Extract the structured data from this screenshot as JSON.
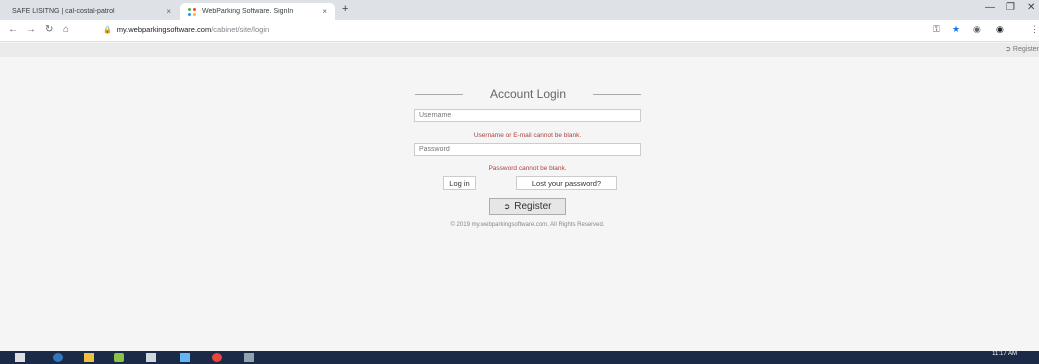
{
  "browser": {
    "tabs": [
      {
        "title": "SAFE LISITNG | cal-costal-patrol",
        "close": "×"
      },
      {
        "title": "WebParking Software. SignIn",
        "close": "×"
      }
    ],
    "new_tab": "+",
    "window_controls": {
      "minimize": "—",
      "maximize": "❐",
      "close": "✕"
    },
    "nav": {
      "back": "←",
      "forward": "→",
      "reload": "↻",
      "home": "⌂"
    },
    "url_host": "my.webparkingsoftware.com",
    "url_path": "/cabinet/site/login",
    "toolbar_icons": [
      "key-icon",
      "star-icon",
      "extension-icon",
      "profile-icon",
      "menu-icon"
    ]
  },
  "page": {
    "top_register_link": "Register",
    "heading": "Account Login",
    "username_placeholder": "Username",
    "username_error": "Username or E-mail cannot be blank.",
    "password_placeholder": "Password",
    "password_error": "Password cannot be blank.",
    "login_button": "Log in",
    "lost_password_button": "Lost your password?",
    "register_button": "Register",
    "footer": "© 2019 my.webparkingsoftware.com. All Rights Reserved."
  },
  "taskbar": {
    "time": "11:17 AM",
    "apps": [
      "windows-start-icon",
      "edge-icon",
      "file-explorer-icon",
      "recycle-icon",
      "store-icon",
      "photos-icon",
      "chrome-icon",
      "app-icon"
    ]
  },
  "colors": {
    "error": "#a94442",
    "page_bg": "#f5f5f5",
    "taskbar": "#1b2a47"
  }
}
